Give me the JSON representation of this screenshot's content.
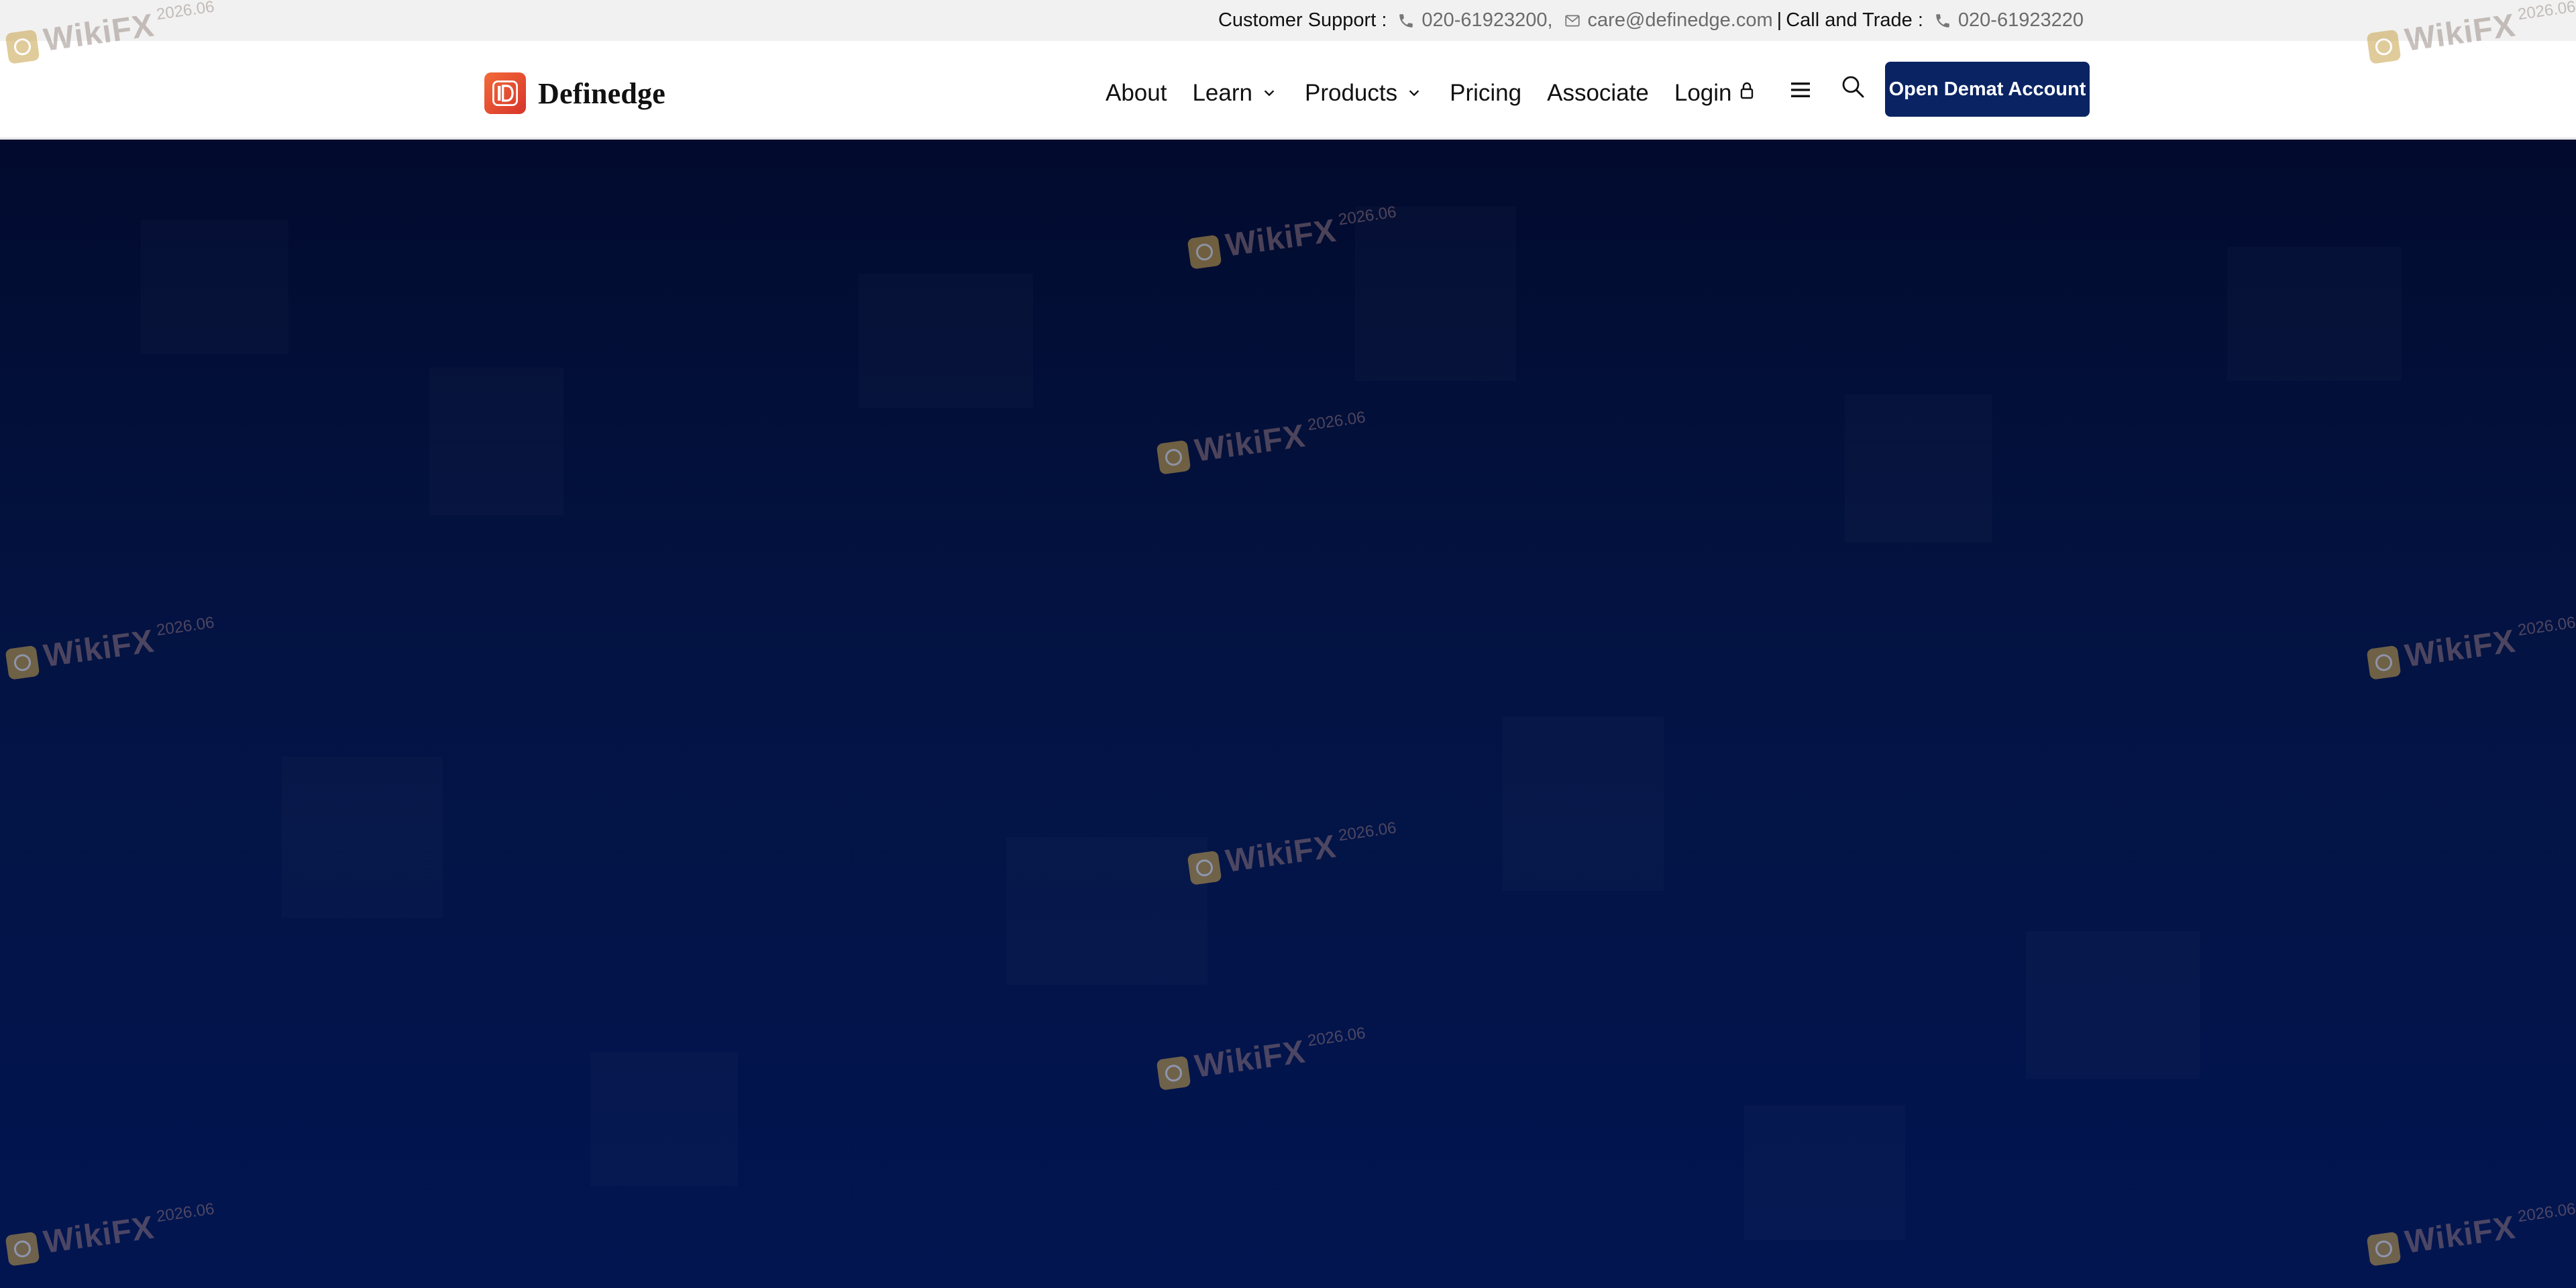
{
  "topbar": {
    "support_label": "Customer Support :",
    "support_phone": "020-61923200,",
    "support_email": "care@definedge.com",
    "separator": "|",
    "trade_label": "Call and Trade :",
    "trade_phone": "020-61923220",
    "icons": [
      "phone-icon",
      "mail-icon",
      "phone-icon"
    ]
  },
  "header": {
    "brand": "Definedge",
    "nav": [
      {
        "label": "About",
        "dropdown": false
      },
      {
        "label": "Learn",
        "dropdown": true
      },
      {
        "label": "Products",
        "dropdown": true
      },
      {
        "label": "Pricing",
        "dropdown": false
      },
      {
        "label": "Associate",
        "dropdown": false
      },
      {
        "label": "Login",
        "dropdown": false,
        "icon": "lock-icon"
      }
    ],
    "menu_icon": "menu-icon",
    "search_icon": "search-icon",
    "cta_label": "Open Demat Account"
  },
  "watermark": {
    "text": "WikiFX",
    "year": "2026.06"
  },
  "colors": {
    "cta_bg": "#0a2463",
    "hero_bg_top": "#020b2e",
    "hero_bg_bottom": "#021550",
    "topbar_bg": "#f1f1f1",
    "brand_orange": "#e2492f"
  }
}
